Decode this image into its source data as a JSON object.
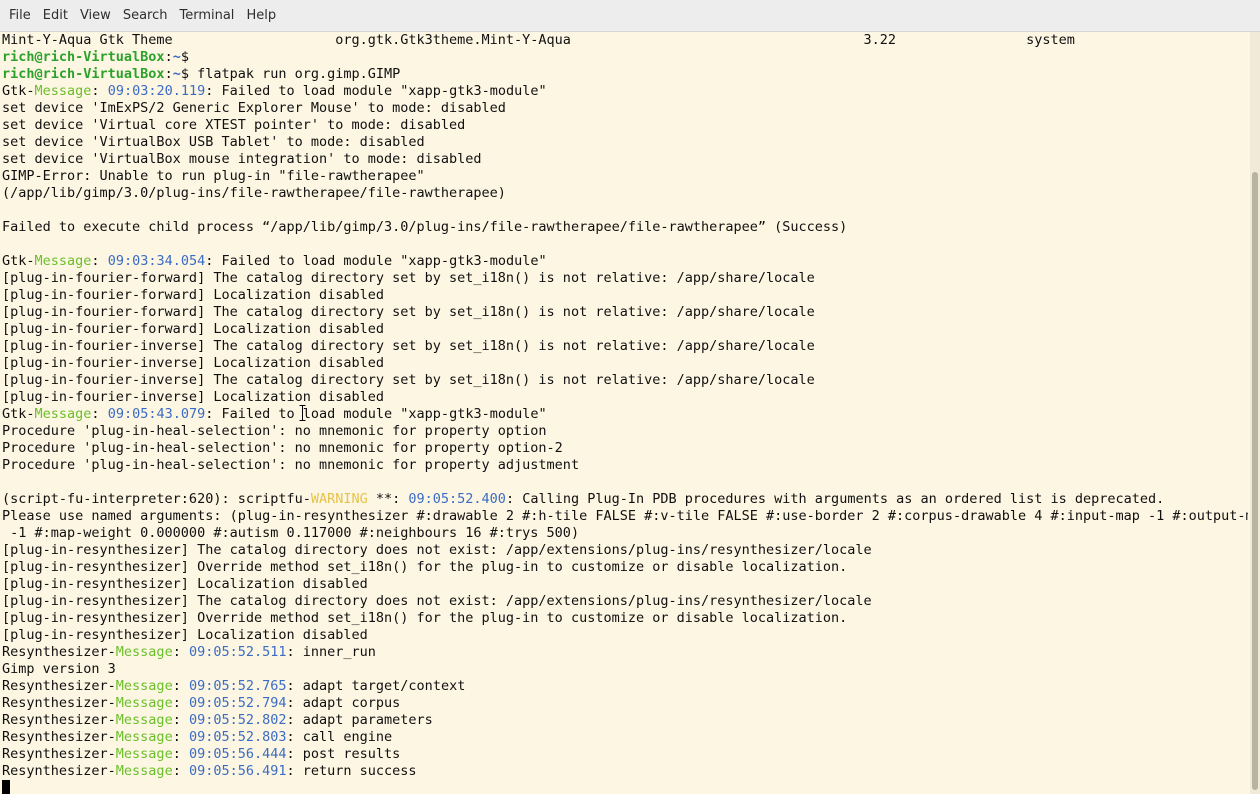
{
  "menubar": {
    "items": [
      "File",
      "Edit",
      "View",
      "Search",
      "Terminal",
      "Help"
    ]
  },
  "terminal": {
    "lines": [
      [
        {
          "t": "Mint-Y-Aqua Gtk Theme                    org.gtk.Gtk3theme.Mint-Y-Aqua                                    3.22                system"
        }
      ],
      [
        {
          "t": "rich@rich-VirtualBox",
          "c": "user"
        },
        {
          "t": ":"
        },
        {
          "t": "~",
          "c": "path"
        },
        {
          "t": "$"
        }
      ],
      [
        {
          "t": "rich@rich-VirtualBox",
          "c": "user"
        },
        {
          "t": ":"
        },
        {
          "t": "~",
          "c": "path"
        },
        {
          "t": "$ flatpak run org.gimp.GIMP"
        }
      ],
      [
        {
          "t": "Gtk-"
        },
        {
          "t": "Message",
          "c": "green"
        },
        {
          "t": ": "
        },
        {
          "t": "09:03:20.119",
          "c": "blue"
        },
        {
          "t": ": Failed to load module \"xapp-gtk3-module\""
        }
      ],
      [
        {
          "t": "set device 'ImExPS/2 Generic Explorer Mouse' to mode: disabled"
        }
      ],
      [
        {
          "t": "set device 'Virtual core XTEST pointer' to mode: disabled"
        }
      ],
      [
        {
          "t": "set device 'VirtualBox USB Tablet' to mode: disabled"
        }
      ],
      [
        {
          "t": "set device 'VirtualBox mouse integration' to mode: disabled"
        }
      ],
      [
        {
          "t": "GIMP-Error: Unable to run plug-in \"file-rawtherapee\""
        }
      ],
      [
        {
          "t": "(/app/lib/gimp/3.0/plug-ins/file-rawtherapee/file-rawtherapee)"
        }
      ],
      [
        {
          "t": ""
        }
      ],
      [
        {
          "t": "Failed to execute child process “/app/lib/gimp/3.0/plug-ins/file-rawtherapee/file-rawtherapee” (Success)"
        }
      ],
      [
        {
          "t": ""
        }
      ],
      [
        {
          "t": "Gtk-"
        },
        {
          "t": "Message",
          "c": "green"
        },
        {
          "t": ": "
        },
        {
          "t": "09:03:34.054",
          "c": "blue"
        },
        {
          "t": ": Failed to load module \"xapp-gtk3-module\""
        }
      ],
      [
        {
          "t": "[plug-in-fourier-forward] The catalog directory set by set_i18n() is not relative: /app/share/locale"
        }
      ],
      [
        {
          "t": "[plug-in-fourier-forward] Localization disabled"
        }
      ],
      [
        {
          "t": "[plug-in-fourier-forward] The catalog directory set by set_i18n() is not relative: /app/share/locale"
        }
      ],
      [
        {
          "t": "[plug-in-fourier-forward] Localization disabled"
        }
      ],
      [
        {
          "t": "[plug-in-fourier-inverse] The catalog directory set by set_i18n() is not relative: /app/share/locale"
        }
      ],
      [
        {
          "t": "[plug-in-fourier-inverse] Localization disabled"
        }
      ],
      [
        {
          "t": "[plug-in-fourier-inverse] The catalog directory set by set_i18n() is not relative: /app/share/locale"
        }
      ],
      [
        {
          "t": "[plug-in-fourier-inverse] Localization disabled"
        }
      ],
      [
        {
          "t": "Gtk-"
        },
        {
          "t": "Message",
          "c": "green"
        },
        {
          "t": ": "
        },
        {
          "t": "09:05:43.079",
          "c": "blue"
        },
        {
          "t": ": Failed to load module \"xapp-gtk3-module\""
        }
      ],
      [
        {
          "t": "Procedure 'plug-in-heal-selection': no mnemonic for property option"
        }
      ],
      [
        {
          "t": "Procedure 'plug-in-heal-selection': no mnemonic for property option-2"
        }
      ],
      [
        {
          "t": "Procedure 'plug-in-heal-selection': no mnemonic for property adjustment"
        }
      ],
      [
        {
          "t": ""
        }
      ],
      [
        {
          "t": "(script-fu-interpreter:620): scriptfu-"
        },
        {
          "t": "WARNING",
          "c": "yellow"
        },
        {
          "t": " **: "
        },
        {
          "t": "09:05:52.400",
          "c": "blue"
        },
        {
          "t": ": Calling Plug-In PDB procedures with arguments as an ordered list is deprecated."
        }
      ],
      [
        {
          "t": "Please use named arguments: (plug-in-resynthesizer #:drawable 2 #:h-tile FALSE #:v-tile FALSE #:use-border 2 #:corpus-drawable 4 #:input-map -1 #:output-map"
        }
      ],
      [
        {
          "t": " -1 #:map-weight 0.000000 #:autism 0.117000 #:neighbours 16 #:trys 500)"
        }
      ],
      [
        {
          "t": "[plug-in-resynthesizer] The catalog directory does not exist: /app/extensions/plug-ins/resynthesizer/locale"
        }
      ],
      [
        {
          "t": "[plug-in-resynthesizer] Override method set_i18n() for the plug-in to customize or disable localization."
        }
      ],
      [
        {
          "t": "[plug-in-resynthesizer] Localization disabled"
        }
      ],
      [
        {
          "t": "[plug-in-resynthesizer] The catalog directory does not exist: /app/extensions/plug-ins/resynthesizer/locale"
        }
      ],
      [
        {
          "t": "[plug-in-resynthesizer] Override method set_i18n() for the plug-in to customize or disable localization."
        }
      ],
      [
        {
          "t": "[plug-in-resynthesizer] Localization disabled"
        }
      ],
      [
        {
          "t": "Resynthesizer-"
        },
        {
          "t": "Message",
          "c": "green"
        },
        {
          "t": ": "
        },
        {
          "t": "09:05:52.511",
          "c": "blue"
        },
        {
          "t": ": inner_run"
        }
      ],
      [
        {
          "t": "Gimp version 3"
        }
      ],
      [
        {
          "t": "Resynthesizer-"
        },
        {
          "t": "Message",
          "c": "green"
        },
        {
          "t": ": "
        },
        {
          "t": "09:05:52.765",
          "c": "blue"
        },
        {
          "t": ": adapt target/context"
        }
      ],
      [
        {
          "t": "Resynthesizer-"
        },
        {
          "t": "Message",
          "c": "green"
        },
        {
          "t": ": "
        },
        {
          "t": "09:05:52.794",
          "c": "blue"
        },
        {
          "t": ": adapt corpus"
        }
      ],
      [
        {
          "t": "Resynthesizer-"
        },
        {
          "t": "Message",
          "c": "green"
        },
        {
          "t": ": "
        },
        {
          "t": "09:05:52.802",
          "c": "blue"
        },
        {
          "t": ": adapt parameters"
        }
      ],
      [
        {
          "t": "Resynthesizer-"
        },
        {
          "t": "Message",
          "c": "green"
        },
        {
          "t": ": "
        },
        {
          "t": "09:05:52.803",
          "c": "blue"
        },
        {
          "t": ": call engine"
        }
      ],
      [
        {
          "t": "Resynthesizer-"
        },
        {
          "t": "Message",
          "c": "green"
        },
        {
          "t": ": "
        },
        {
          "t": "09:05:56.444",
          "c": "blue"
        },
        {
          "t": ": post results"
        }
      ],
      [
        {
          "t": "Resynthesizer-"
        },
        {
          "t": "Message",
          "c": "green"
        },
        {
          "t": ": "
        },
        {
          "t": "09:05:56.491",
          "c": "blue"
        },
        {
          "t": ": return success"
        }
      ]
    ]
  },
  "colors": {
    "background": "#fdf6e3",
    "text": "#101010",
    "prompt_user": "#2ca22c",
    "prompt_path": "#3b6cc4",
    "message_tag": "#6bbf2a",
    "timestamp": "#3b6cc4",
    "warning_tag": "#e6c34a"
  },
  "icons": {
    "text_cursor": "i-beam-cursor-icon",
    "block_cursor": "terminal-block-cursor"
  }
}
